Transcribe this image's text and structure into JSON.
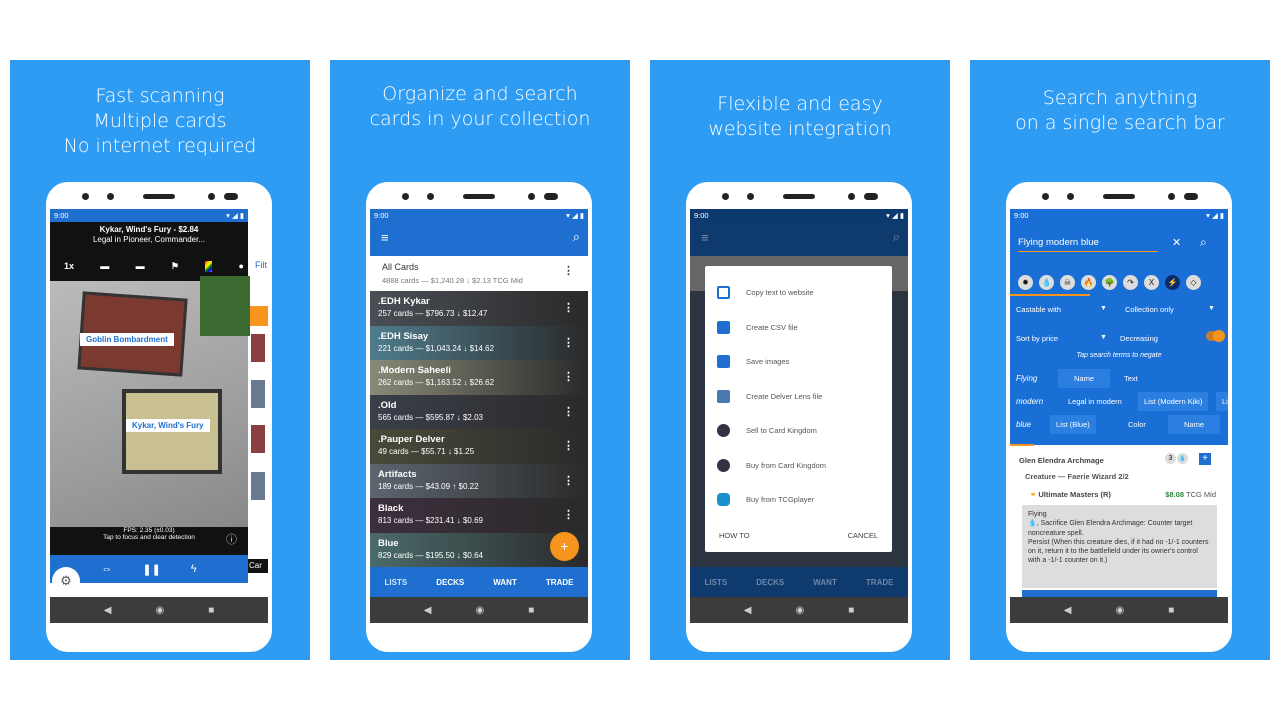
{
  "panels": [
    {
      "headline": [
        "Fast scanning",
        "Multiple cards",
        "No internet required"
      ]
    },
    {
      "headline": [
        "Organize and search",
        "cards in your collection"
      ]
    },
    {
      "headline": [
        "Flexible and easy",
        "website integration"
      ]
    },
    {
      "headline": [
        "Search anything",
        "on a single search bar"
      ]
    }
  ],
  "status_time": "9:00",
  "scanner": {
    "card_title": "Kykar, Wind's Fury - $2.84",
    "legal": "Legal in Pioneer, Commander...",
    "zoom": "1x",
    "labels": [
      "Goblin Bombardment",
      "Kykar, Wind's Fury"
    ],
    "fps": "FPS: 2.35 (±0.03)",
    "hint": "Tap to focus and clear detection",
    "side_filter": "Filt",
    "side_card": "Car"
  },
  "lists": {
    "all": {
      "title": "All Cards",
      "sub": "4888 cards — $1,240.28 ↓ $2.13 TCG Mid"
    },
    "items": [
      {
        "title": ".EDH Kykar",
        "sub": "257 cards — $796.73 ↓ $12.47",
        "color": "#4a4e55"
      },
      {
        "title": ".EDH Sisay",
        "sub": "221 cards — $1,043.24 ↓ $14.62",
        "color": "#4f7c8c"
      },
      {
        "title": ".Modern Saheeli",
        "sub": "262 cards — $1,163.52 ↓ $26.62",
        "color": "#8a8a78"
      },
      {
        "title": ".Old",
        "sub": "565 cards — $595.87 ↓ $2.03",
        "color": "#3b3f4a"
      },
      {
        "title": ".Pauper Delver",
        "sub": "49 cards — $55.71 ↓ $1.25",
        "color": "#4a4a3a"
      },
      {
        "title": "Artifacts",
        "sub": "189 cards — $43.09 ↑ $0.22",
        "color": "#5c6670"
      },
      {
        "title": "Black",
        "sub": "813 cards — $231.41 ↓ $0.69",
        "color": "#3d2f3e"
      },
      {
        "title": "Blue",
        "sub": "829 cards — $195.50 ↓ $0.64",
        "color": "#4b6a6a"
      }
    ],
    "tabs": [
      "LISTS",
      "DECKS",
      "WANT",
      "TRADE"
    ],
    "fab": "+"
  },
  "export_dialog": {
    "items": [
      "Copy text to website",
      "Create CSV file",
      "Save images",
      "Create Delver Lens file",
      "Sell to Card Kingdom",
      "Buy from Card Kingdom",
      "Buy from TCGplayer"
    ],
    "how_to": "HOW TO",
    "cancel": "CANCEL"
  },
  "search": {
    "query": "Flying modern blue",
    "mana_symbols": [
      "✹",
      "💧",
      "☠",
      "🔥",
      "🌳",
      "↷",
      "X",
      "⚡",
      "◇"
    ],
    "castable": "Castable with",
    "collection": "Collection only",
    "sort": "Sort by price",
    "order": "Decreasing",
    "hint": "Tap search terms to negate",
    "terms": [
      {
        "term": "Flying",
        "options": [
          "Name",
          "Text"
        ]
      },
      {
        "term": "modern",
        "options": [
          "Legal in modern",
          "List (Modern Kiki)",
          "Li"
        ]
      },
      {
        "term": "blue",
        "options": [
          "List (Blue)",
          "Color",
          "Name"
        ]
      }
    ],
    "result": {
      "name": "Glen Elendra Archmage",
      "cost": "3",
      "type": "Creature — Faerie Wizard 2/2",
      "set": "Ultimate Masters (R)",
      "price": "$8.08",
      "price_src": "TCG Mid",
      "text": [
        "Flying",
        "💧, Sacrifice Glen Elendra Archmage: Counter target noncreature spell.",
        "Persist (When this creature dies, if it had no -1/-1 counters on it, return it to the battlefield under its owner's control with a -1/-1 counter on it.)"
      ]
    }
  },
  "colors": {
    "panel": "#2f9cf4",
    "app_blue": "#1e6fd0",
    "accent": "#f7941d"
  }
}
